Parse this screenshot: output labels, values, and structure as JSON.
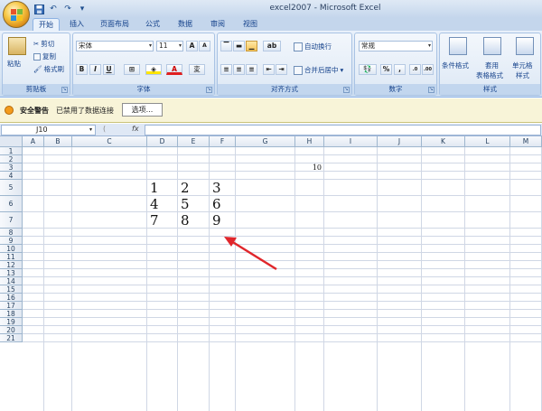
{
  "window": {
    "title": "excel2007 - Microsoft Excel"
  },
  "quick_access": {
    "save_icon": "save-icon",
    "undo_icon": "undo-icon",
    "redo_icon": "redo-icon",
    "customize": "▾"
  },
  "tabs": [
    {
      "label": "开始",
      "active": true
    },
    {
      "label": "插入",
      "active": false
    },
    {
      "label": "页面布局",
      "active": false
    },
    {
      "label": "公式",
      "active": false
    },
    {
      "label": "数据",
      "active": false
    },
    {
      "label": "审阅",
      "active": false
    },
    {
      "label": "视图",
      "active": false
    }
  ],
  "ribbon": {
    "clipboard": {
      "label": "剪贴板",
      "paste": "粘贴",
      "cut": "剪切",
      "copy": "复制",
      "format_painter": "格式刷"
    },
    "font": {
      "label": "字体",
      "font_name": "宋体",
      "font_size": "11",
      "grow": "A",
      "shrink": "A",
      "bold": "B",
      "italic": "I",
      "underline": "U",
      "font_color": "A",
      "phonetic": "変"
    },
    "alignment": {
      "label": "对齐方式",
      "wrap_text": "自动换行",
      "merge_center": "合并后居中"
    },
    "number": {
      "label": "数字",
      "format": "常规",
      "percent": "%",
      "comma": ","
    },
    "styles": {
      "label": "样式",
      "conditional": "条件格式",
      "table_line1": "套用",
      "table_line2": "表格格式",
      "cell_line1": "单元格",
      "cell_line2": "样式"
    }
  },
  "security_bar": {
    "title": "安全警告",
    "message": "已禁用了数据连接",
    "options_button": "选项..."
  },
  "formula_bar": {
    "name_box": "J10",
    "fx": "fx",
    "content": ""
  },
  "columns": [
    "A",
    "B",
    "C",
    "D",
    "E",
    "F",
    "G",
    "H",
    "I",
    "J",
    "K",
    "L",
    "M"
  ],
  "rows": [
    "1",
    "2",
    "3",
    "4",
    "5",
    "6",
    "7",
    "8",
    "9",
    "10",
    "11",
    "12",
    "13",
    "14",
    "15",
    "16",
    "17",
    "18",
    "19",
    "20",
    "21"
  ],
  "cells": {
    "H3": "10",
    "D5": "1",
    "E5": "2",
    "F5": "3",
    "D6": "4",
    "E6": "5",
    "F6": "6",
    "D7": "7",
    "E7": "8",
    "F7": "9"
  },
  "annotation": {
    "arrow_color": "#e0262b",
    "arrow_icon": "red-arrow-icon"
  }
}
